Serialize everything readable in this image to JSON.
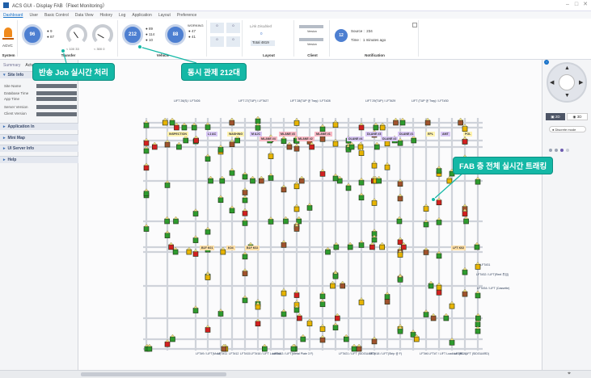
{
  "app": {
    "title": "ACS GUI - Display FAB（Fleet Monitoring）"
  },
  "menu": [
    "Dashboard",
    "User",
    "Basic Control",
    "Data View",
    "History",
    "Log",
    "Application",
    "Layout",
    "Preference"
  ],
  "toolbar": {
    "system": {
      "label": "System",
      "name": "AGVC"
    },
    "transfer": {
      "label": "Transfer",
      "total": "96",
      "stat_a": "9",
      "stat_b": "87",
      "gauge_a": "< 100  33",
      "gauge_b": "< 300  0"
    },
    "vehicle": {
      "label": "Vehicle",
      "total": "212",
      "stat_a": "89",
      "stat_b": "114",
      "stat_c": "10",
      "total2": "88",
      "working_label": "WORKING",
      "work_a": "47",
      "work_b": "41"
    },
    "layout": {
      "label": "Layout",
      "link_disabled": "Link Disabled",
      "link_value": "0",
      "total_label": "Total",
      "total_value": "4819"
    },
    "client": {
      "label": "Client",
      "version_label": "Version"
    },
    "notification": {
      "label": "Notification",
      "count": "12",
      "source_label": "Source :",
      "source_value": "234",
      "time_label": "Time :",
      "time_value": "1 minutes ago"
    }
  },
  "sidebar": {
    "tabs": [
      "Summary",
      "Actv"
    ],
    "site_info": {
      "title": "Site Info",
      "rows": [
        "Site Name",
        "Database Time",
        "App Time",
        "Server Version",
        "Client Version"
      ]
    },
    "sections": [
      "Application In",
      "Mini Map",
      "UI Server Info",
      "Help"
    ]
  },
  "callouts": {
    "job": "반송 Job 실시간 처리",
    "control": "동시 관제 212대",
    "tracking": "FAB 층 전체 실시간 트래킹"
  },
  "map": {
    "zones": [
      {
        "text": "INSPECTION",
        "bg": "#fff3b0"
      },
      {
        "text": "L1 AC",
        "bg": "#d9c8f5"
      },
      {
        "text": "WASHING",
        "bg": "#fff3b0"
      },
      {
        "text": "M AJC",
        "bg": "#d9c8f5"
      },
      {
        "text": "MLANE #4",
        "bg": "#f7b9c4"
      },
      {
        "text": "MLANE #3",
        "bg": "#f7b9c4"
      },
      {
        "text": "MLANE #2",
        "bg": "#f7b9c4"
      },
      {
        "text": "MLANE #1",
        "bg": "#f7b9c4"
      },
      {
        "text": "DLANE #3",
        "bg": "#d9c8f5"
      },
      {
        "text": "DLANE #4",
        "bg": "#d9c8f5"
      },
      {
        "text": "DLANE #1",
        "bg": "#d9c8f5"
      },
      {
        "text": "DLANE #2",
        "bg": "#d9c8f5"
      },
      {
        "text": "EPL",
        "bg": "#fff3b0"
      },
      {
        "text": "AMT",
        "bg": "#d9c8f5"
      },
      {
        "text": "POL",
        "bg": "#fff3b0"
      },
      {
        "text": "B1F K01",
        "bg": "#ffe0a8"
      },
      {
        "text": "K04",
        "bg": "#ffe0a8"
      },
      {
        "text": "B1F K02",
        "bg": "#ffe0a8"
      },
      {
        "text": "LFT K02",
        "bg": "#ffe0a8"
      }
    ],
    "lifts": [
      "LIFT 26(S) / LFT#26",
      "LIFT 27(TUP) / LFT#27",
      "LIFT 28(TUP 공 Tray) / LFT#28",
      "LIFT 29(TUP) / LFT#29",
      "LIFT (TUP 공 Tray) / LFT#30",
      "LFT#31",
      "LFT#32 / LIFT(Reel 투입)",
      "LFT#34 / LIFT (Cassette)",
      "LFT#9 / LIFT(Mold)",
      "LFT#11",
      "LFT#12",
      "LFT#15",
      "LFT#16 / LIFT Loadlock",
      "LIFT#13 / LIFT(Metal Plate 3 F)",
      "LFT#21 / LIFT (SIDGUARD)",
      "LFT#18 / LIFT(Strip 공 F)",
      "LFT#6 LFT#7 / LIFT Loadlock (RCV)",
      "LFT#5 / LIFT (SIDGUARD)"
    ]
  },
  "rightpanel": {
    "tab_a": "2D",
    "tab_b": "3D",
    "mode_label": "Discrete mode"
  },
  "colors": {
    "accent": "#1a73c9",
    "circle_blue": "#4d7fd1",
    "callout": "#14b8a6",
    "agv_green": "#2e9b2e",
    "agv_red": "#d32020",
    "agv_yellow": "#e8b400"
  }
}
